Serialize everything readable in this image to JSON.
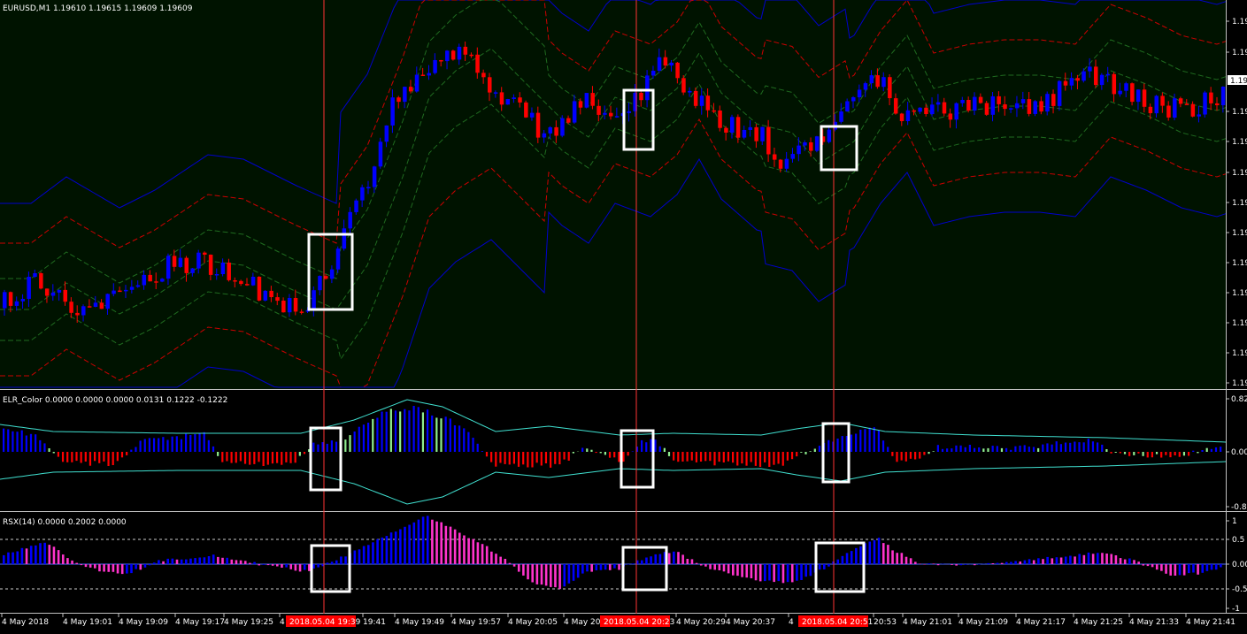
{
  "window": {
    "main_title": "EURUSD,M1  1.19610 1.19615 1.19609 1.19609",
    "elr_title": "ELR_Color 0.0000 0.0000 0.0000 0.0131 0.1222 -0.1222",
    "rsx_title": "RSX(14) 0.0000 0.2002 0.0000"
  },
  "price_axis": {
    "labels": [
      "1.19",
      "1.19",
      "1.19",
      "1.19",
      "1.19",
      "1.19",
      "1.19",
      "1.19",
      "1.19",
      "1.19",
      "1.19",
      "1.19",
      "1.19"
    ],
    "current_price": "1.19"
  },
  "elr_axis": {
    "labels": [
      "0.82",
      "0.00",
      "-0.8"
    ]
  },
  "rsx_axis": {
    "labels": [
      "1",
      "0.5",
      "0.00",
      "-0.5",
      "-1"
    ]
  },
  "time_axis": {
    "labels": [
      "4 May 2018",
      "4 May 19:01",
      "4 May 19:09",
      "4 May 19:17",
      "4 May 19:25",
      "4",
      "19:41",
      "4 May 19:49",
      "4 May 19:57",
      "4 May 20:05",
      "4 May 20",
      "4 May 20:29",
      "4 May 20:37",
      "4",
      "20:53",
      "4 May 21:01",
      "4 May 21:09",
      "4 May 21:17",
      "4 May 21:25",
      "4 May 21:33",
      "4 May 21:41"
    ],
    "markers": [
      "2018.05.04 19:39",
      "2018.05.04 20:23",
      "2018.05.04 20:51"
    ]
  },
  "colors": {
    "main_bg": "#001300",
    "bull": "#0000ff",
    "bear": "#ff0000",
    "band_outer": "#0000cc",
    "band_mid": "#cc0000",
    "band_inner": "#1f6b1f",
    "elr_bull": "#0000ff",
    "elr_bear": "#ff0000",
    "elr_neutral": "#90ee90",
    "elr_env": "#40e0d0",
    "rsx_blue": "#0000ff",
    "rsx_pink": "#ff33cc",
    "vline": "#ff3333",
    "marker_bg": "#ff0000",
    "box": "#ffffff"
  }
}
